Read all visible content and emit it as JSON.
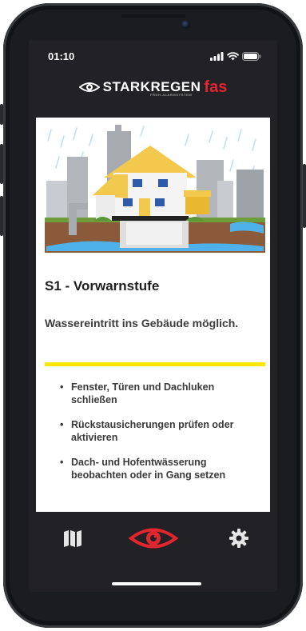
{
  "status_bar": {
    "time": "01:10",
    "icons": [
      "signal-icon",
      "wifi-icon",
      "battery-icon"
    ]
  },
  "app_header": {
    "brand_part1": "STARK",
    "brand_part2": "REGEN",
    "brand_suffix": "fas",
    "tagline": "FRÜH-ALARMSYSTEM",
    "logo_icon": "eye-icon"
  },
  "alert_card": {
    "illustration": "house-in-heavy-rain-with-flooding",
    "title": "S1 - Vorwarnstufe",
    "description": "Wassereintritt ins Gebäude möglich.",
    "divider_color": "#ffe600",
    "bullet_symbol": "•",
    "measures": [
      "Fenster, Türen und Dachluken schließen",
      "Rückstausicherungen prüfen oder aktivieren",
      "Dach- und Hofentwässerung beobachten oder in Gang setzen"
    ]
  },
  "tab_bar": {
    "tabs": [
      {
        "icon": "map-icon",
        "active": false
      },
      {
        "icon": "eye-icon",
        "active": true
      },
      {
        "icon": "gear-icon",
        "active": false
      }
    ],
    "active_color": "#e0262f",
    "inactive_color": "#e6e6e6"
  }
}
